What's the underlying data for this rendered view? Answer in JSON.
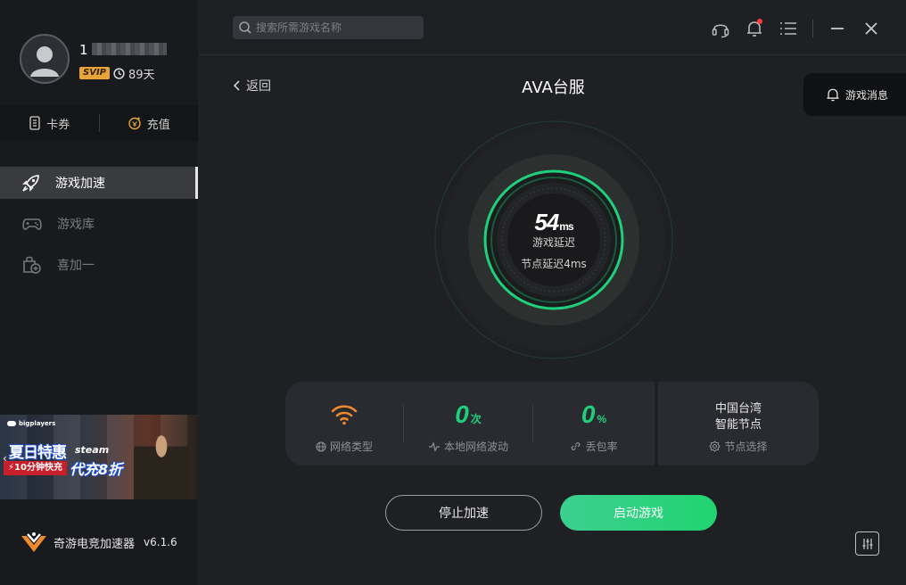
{
  "user": {
    "name": "1",
    "vip_badge": "SVIP",
    "days": "89天"
  },
  "wallet": {
    "coupon": "卡券",
    "recharge": "充值"
  },
  "nav": {
    "items": [
      {
        "label": "游戏加速"
      },
      {
        "label": "游戏库"
      },
      {
        "label": "喜加一"
      }
    ]
  },
  "banner": {
    "brand": "bigplayers",
    "title": "夏日特惠",
    "steam": "steam",
    "sub": "10分钟快充",
    "sub2": "代充8折"
  },
  "app": {
    "name": "奇游电竞加速器",
    "version": "v6.1.6"
  },
  "search": {
    "placeholder": "搜索所需游戏名称"
  },
  "header": {
    "back": "返回",
    "game_title": "AVA台服",
    "messages": "游戏消息"
  },
  "gauge": {
    "latency": "54",
    "latency_unit": "ms",
    "label": "游戏延迟",
    "node_latency": "节点延迟4ms"
  },
  "stats": {
    "network_type": "网络类型",
    "fluctuation_value": "0",
    "fluctuation_unit": "次",
    "fluctuation_label": "本地网络波动",
    "loss_value": "0",
    "loss_unit": "%",
    "loss_label": "丢包率",
    "node_region": "中国台湾",
    "node_mode": "智能节点",
    "node_select": "节点选择"
  },
  "buttons": {
    "stop": "停止加速",
    "start": "启动游戏"
  },
  "colors": {
    "accent": "#1ed07b",
    "wifi": "#f0892d",
    "vip": "#e8a33a"
  }
}
